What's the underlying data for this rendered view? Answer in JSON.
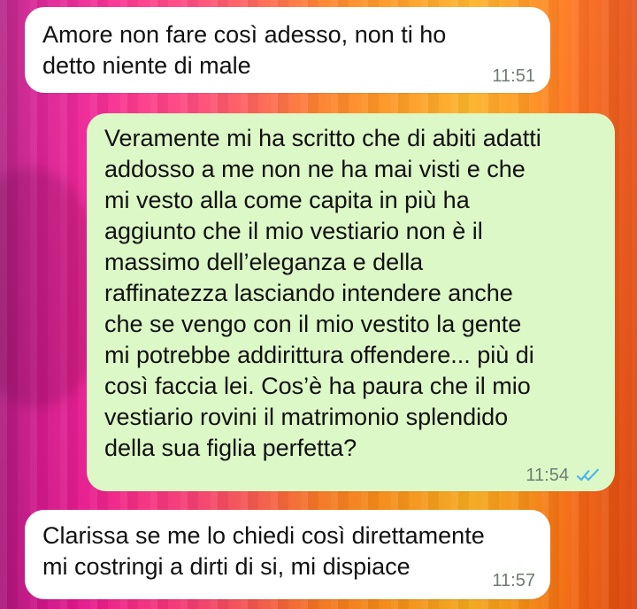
{
  "messages": [
    {
      "type": "incoming",
      "text": "Amore non fare così adesso, non ti ho\ndetto niente di male",
      "time": "11:51"
    },
    {
      "type": "outgoing",
      "text": "Veramente mi ha scritto che di abiti adatti\naddosso a me non ne ha mai visti e che\nmi vesto alla come capita in più ha\naggiunto che il mio vestiario non è il\nmassimo dell’eleganza e della\nraffinatezza lasciando intendere anche\nche se vengo con il mio vestito la gente\nmi potrebbe addirittura offendere... più di\ncosì faccia lei. Cos’è ha paura che il mio\nvestiario rovini il matrimonio splendido\ndella sua figlia perfetta?",
      "time": "11:54",
      "status_icon": "double-check-read-icon",
      "status_color": "#4fb6ec"
    },
    {
      "type": "incoming",
      "text": "Clarissa se me lo chiedi così direttamente\nmi costringi a dirti di si, mi dispiace",
      "time": "11:57"
    }
  ],
  "colors": {
    "incoming_bubble": "#ffffff",
    "outgoing_bubble": "#dcf8c6",
    "timestamp": "#6f7c72",
    "read_ticks": "#4fb6ec"
  }
}
